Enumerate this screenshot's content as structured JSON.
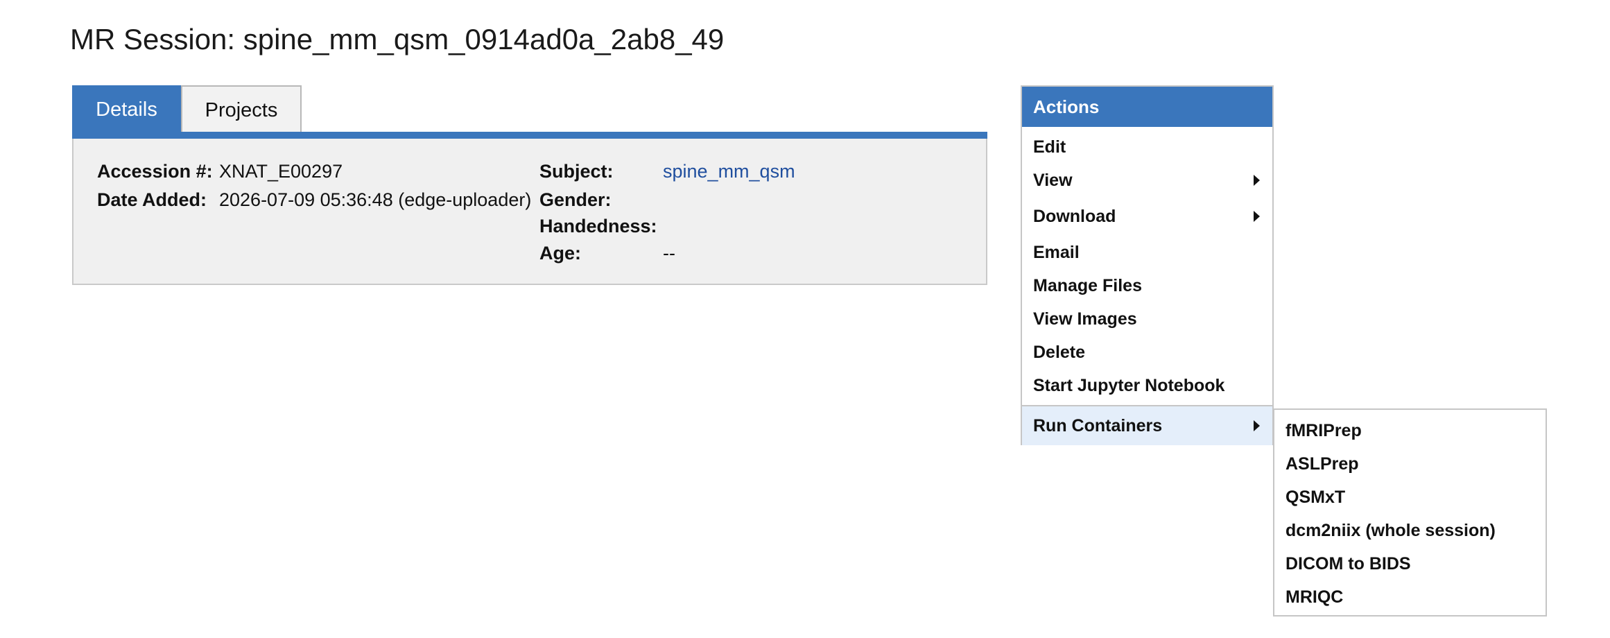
{
  "page": {
    "title": "MR Session: spine_mm_qsm_0914ad0a_2ab8_49"
  },
  "tabs": [
    {
      "label": "Details",
      "active": true
    },
    {
      "label": "Projects",
      "active": false
    }
  ],
  "details": {
    "accession_label": "Accession #:",
    "accession_value": "XNAT_E00297",
    "date_added_label": "Date Added:",
    "date_added_value": "2026-07-09 05:36:48 (edge-uploader)",
    "subject_label": "Subject:",
    "subject_value": "spine_mm_qsm",
    "gender_label": "Gender:",
    "gender_value": "",
    "handedness_label": "Handedness:",
    "handedness_value": "",
    "age_label": "Age:",
    "age_value": "--"
  },
  "actions": {
    "header": "Actions",
    "items": [
      {
        "label": "Edit",
        "has_submenu": false
      },
      {
        "label": "View",
        "has_submenu": true
      },
      {
        "label": "Download",
        "has_submenu": true
      },
      {
        "label": "Email",
        "has_submenu": false
      },
      {
        "label": "Manage Files",
        "has_submenu": false
      },
      {
        "label": "View Images",
        "has_submenu": false
      },
      {
        "label": "Delete",
        "has_submenu": false
      },
      {
        "label": "Start Jupyter Notebook",
        "has_submenu": false
      },
      {
        "label": "Run Containers",
        "has_submenu": true,
        "active": true
      }
    ]
  },
  "run_containers_submenu": {
    "items": [
      {
        "label": "fMRIPrep"
      },
      {
        "label": "ASLPrep"
      },
      {
        "label": "QSMxT"
      },
      {
        "label": "dcm2niix (whole session)"
      },
      {
        "label": "DICOM to BIDS"
      },
      {
        "label": "MRIQC"
      }
    ]
  },
  "colors": {
    "accent": "#3a76bc",
    "link": "#1f4e9e",
    "panel_bg": "#f0f0f0",
    "active_item_bg": "#e4eefa"
  }
}
